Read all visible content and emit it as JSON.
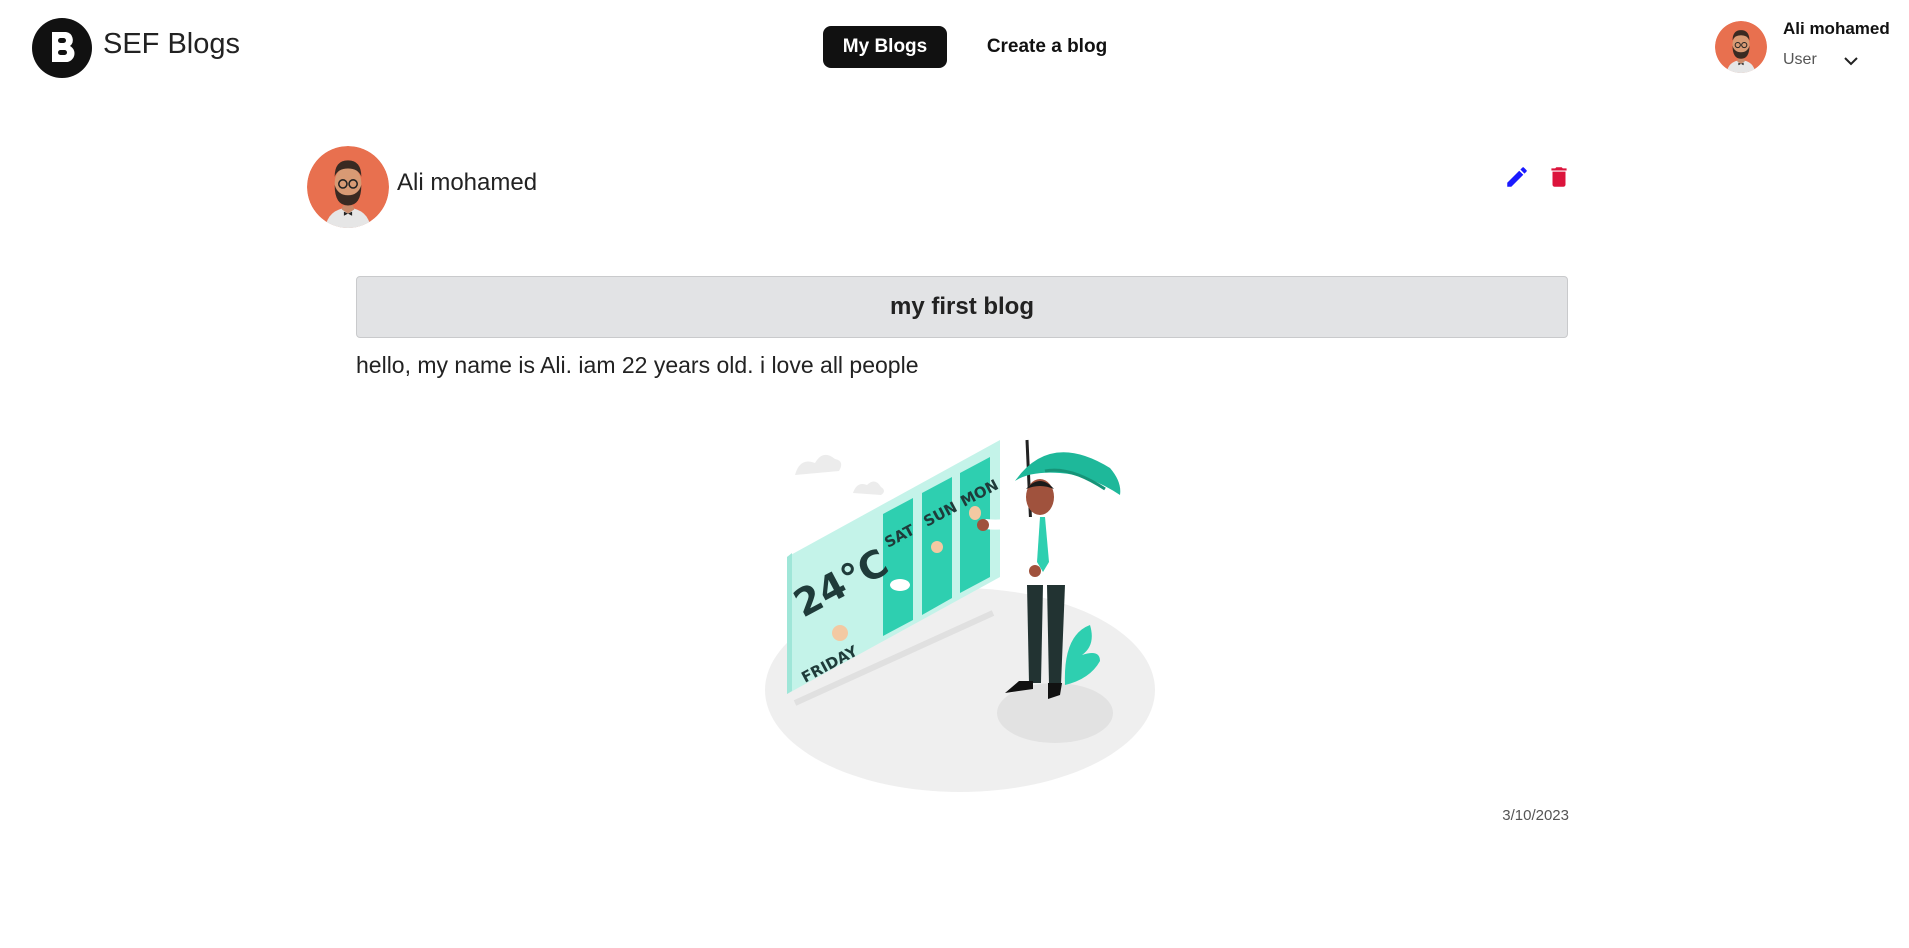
{
  "header": {
    "brand": "SEF Blogs",
    "logo_icon": "blogger-b-icon",
    "nav": [
      {
        "label": "My Blogs",
        "active": true
      },
      {
        "label": "Create a blog",
        "active": false
      }
    ],
    "user": {
      "name": "Ali mohamed",
      "role": "User",
      "avatar_icon": "bearded-man-avatar",
      "menu_icon": "chevron-down-icon"
    }
  },
  "post": {
    "author": "Ali mohamed",
    "author_avatar": "bearded-man-avatar",
    "title": "my first blog",
    "body": "hello, my name is Ali. iam 22 years old. i love all people",
    "date": "3/10/2023",
    "image": {
      "icon": "weather-forecast-illustration",
      "temp": "24°C",
      "today": "FRIDAY",
      "days": [
        "SAT",
        "SUN",
        "MON"
      ]
    },
    "actions": {
      "edit_icon": "pencil-icon",
      "delete_icon": "trash-icon"
    }
  },
  "colors": {
    "accent_dark": "#111111",
    "avatar_bg": "#e8704f",
    "edit": "#1a1aff",
    "delete": "#dc143c",
    "teal": "#2ecfb0",
    "title_bg": "#e2e3e5"
  }
}
